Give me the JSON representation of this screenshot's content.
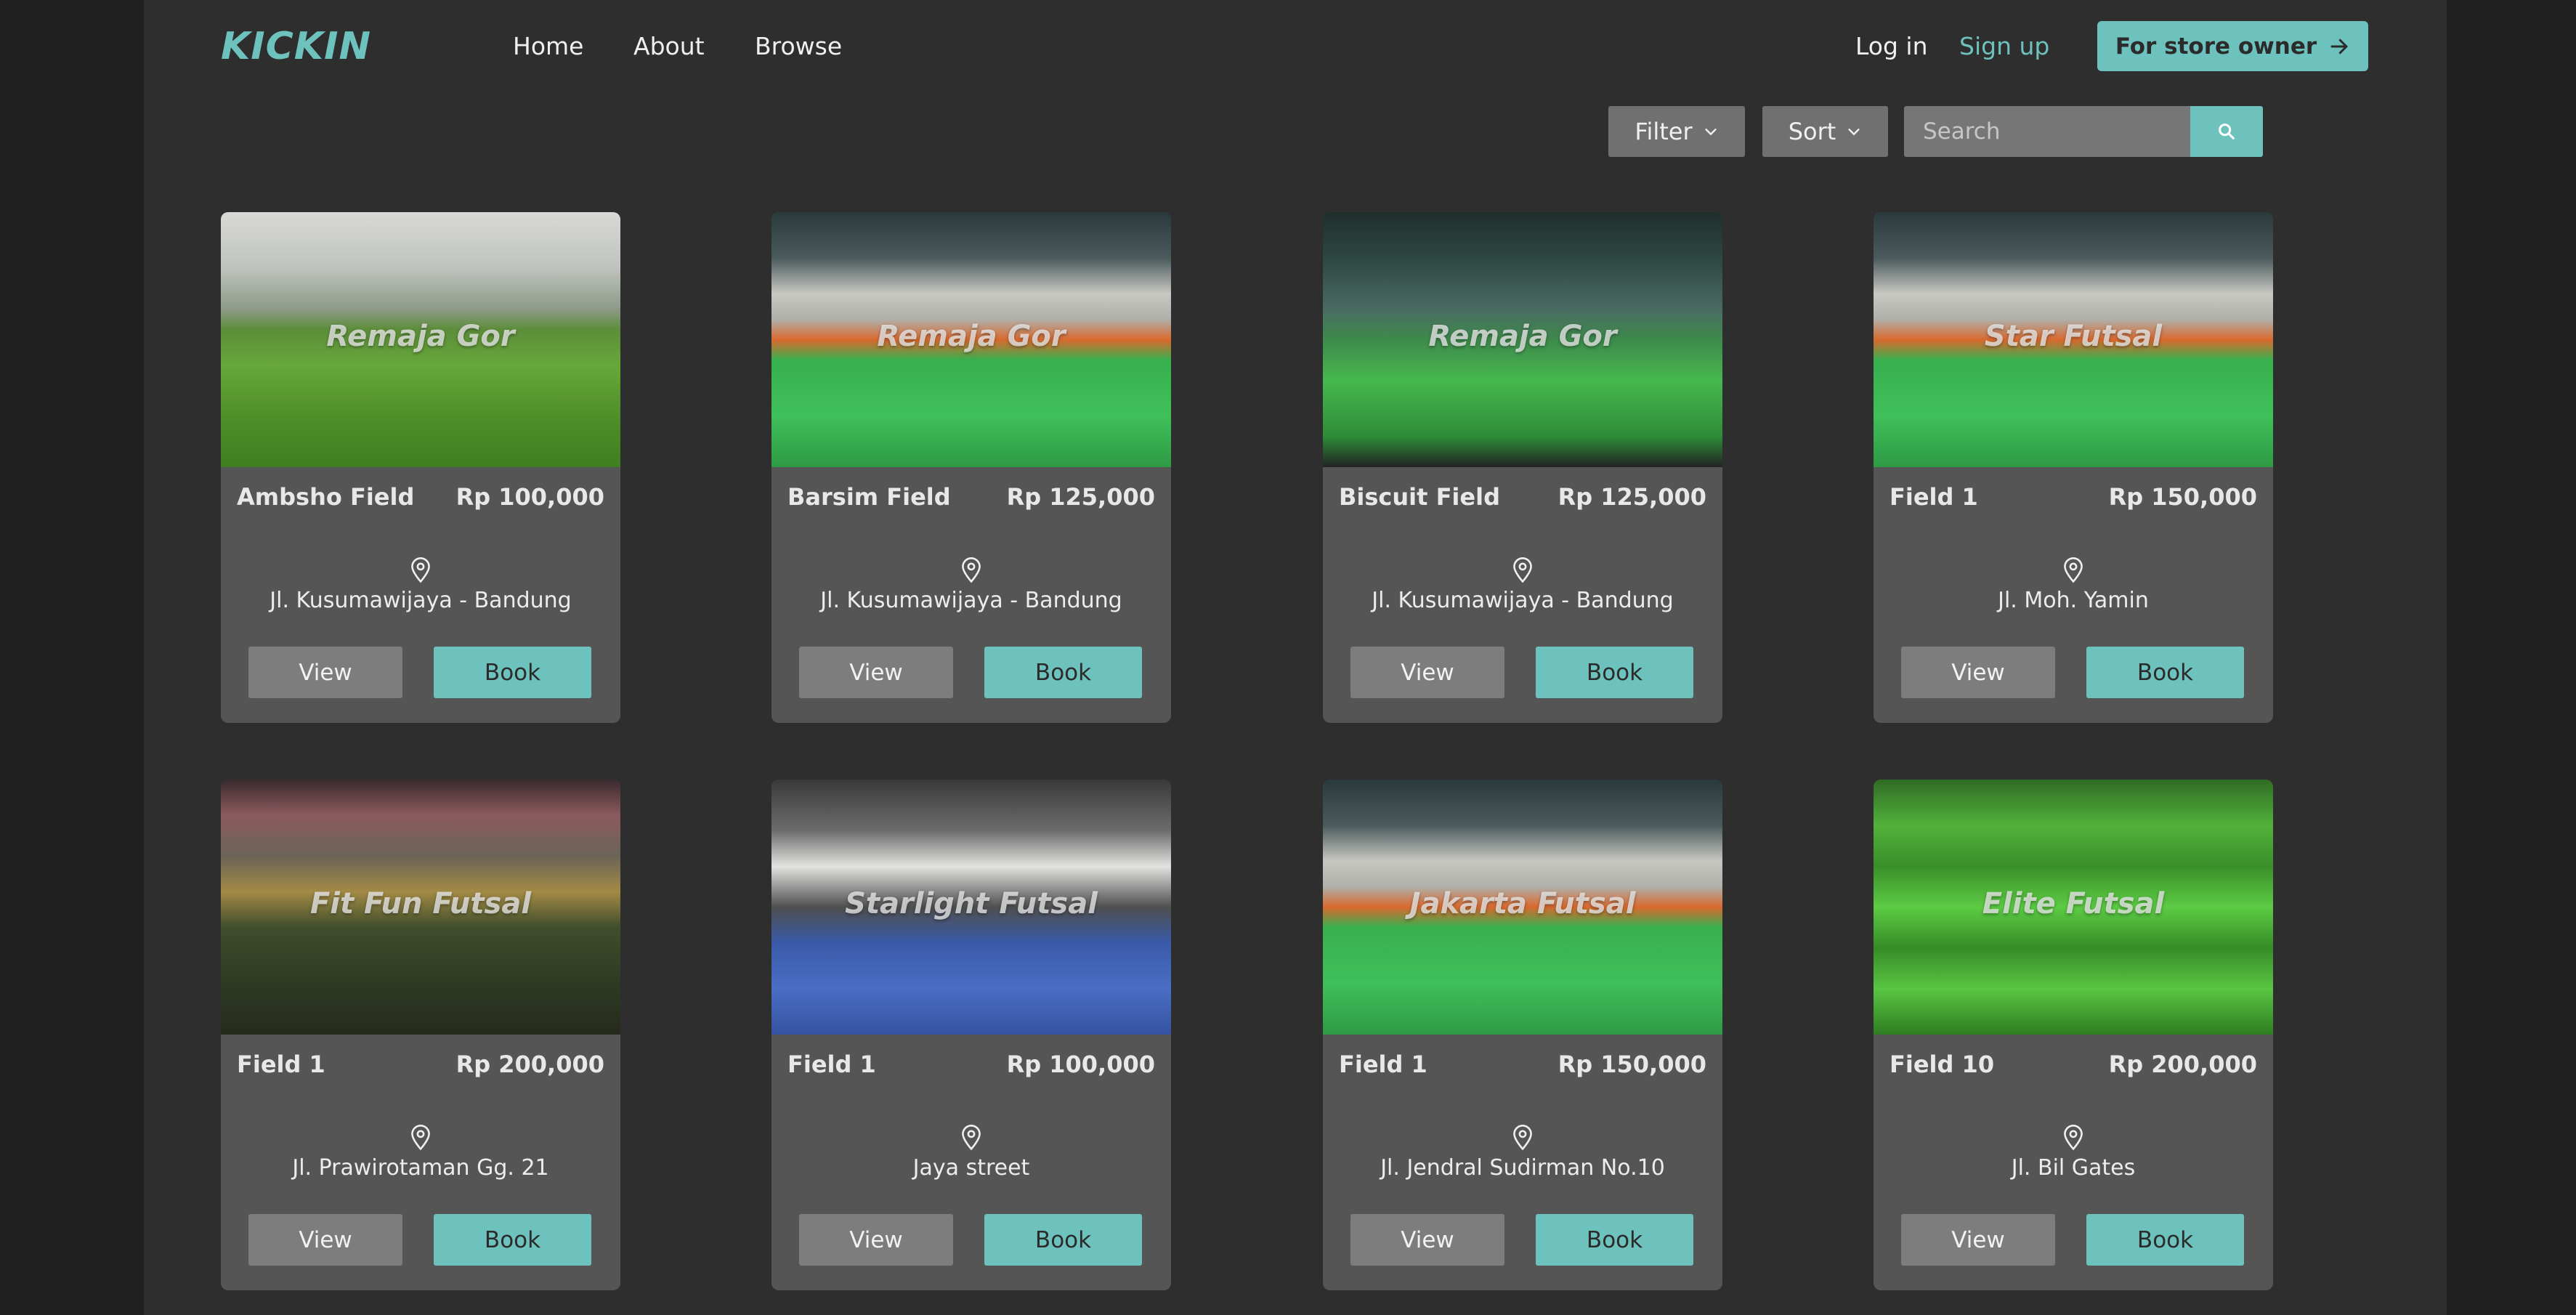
{
  "brand": {
    "logo": "KICKIN",
    "accent": "#6ec2bd"
  },
  "nav": {
    "links": [
      "Home",
      "About",
      "Browse"
    ],
    "login": "Log in",
    "signup": "Sign up",
    "store_owner": "For store owner",
    "store_owner_icon": "arrow-right-icon"
  },
  "toolbar": {
    "filter": "Filter",
    "sort": "Sort",
    "search_placeholder": "Search",
    "search_icon": "search-icon"
  },
  "fields": [
    {
      "image_label": "Remaja Gor",
      "name": "Ambsho Field",
      "price": "Rp 100,000",
      "address": "Jl. Kusumawijaya - Bandung",
      "view": "View",
      "book": "Book"
    },
    {
      "image_label": "Remaja Gor",
      "name": "Barsim Field",
      "price": "Rp 125,000",
      "address": "Jl. Kusumawijaya - Bandung",
      "view": "View",
      "book": "Book"
    },
    {
      "image_label": "Remaja Gor",
      "name": "Biscuit Field",
      "price": "Rp 125,000",
      "address": "Jl. Kusumawijaya - Bandung",
      "view": "View",
      "book": "Book"
    },
    {
      "image_label": "Star Futsal",
      "name": "Field 1",
      "price": "Rp 150,000",
      "address": "Jl. Moh. Yamin",
      "view": "View",
      "book": "Book"
    },
    {
      "image_label": "Fit Fun Futsal",
      "name": "Field 1",
      "price": "Rp 200,000",
      "address": "Jl. Prawirotaman Gg. 21",
      "view": "View",
      "book": "Book"
    },
    {
      "image_label": "Starlight Futsal",
      "name": "Field 1",
      "price": "Rp 100,000",
      "address": "Jaya street",
      "view": "View",
      "book": "Book"
    },
    {
      "image_label": "Jakarta Futsal",
      "name": "Field 1",
      "price": "Rp 150,000",
      "address": "Jl. Jendral Sudirman No.10",
      "view": "View",
      "book": "Book"
    },
    {
      "image_label": "Elite Futsal",
      "name": "Field 10",
      "price": "Rp 200,000",
      "address": "Jl. Bil Gates",
      "view": "View",
      "book": "Book"
    }
  ]
}
